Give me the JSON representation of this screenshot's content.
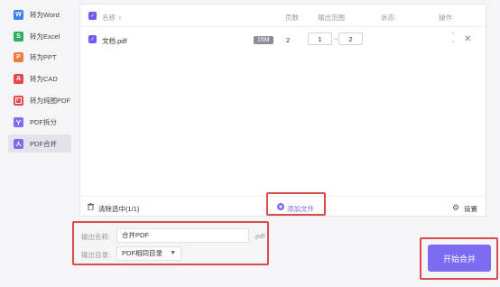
{
  "sidebar": {
    "items": [
      {
        "label": "转为Word",
        "icon": "word-icon",
        "glyph": "W",
        "color": "#3b7ff0"
      },
      {
        "label": "转为Excel",
        "icon": "excel-icon",
        "glyph": "S",
        "color": "#2fae62"
      },
      {
        "label": "转为PPT",
        "icon": "ppt-icon",
        "glyph": "P",
        "color": "#f07a3b"
      },
      {
        "label": "转为CAD",
        "icon": "cad-icon",
        "glyph": "A",
        "color": "#e24b4b"
      },
      {
        "label": "转为纯图PDF",
        "icon": "image-pdf-icon",
        "glyph": "▣",
        "color": "#e24b4b"
      },
      {
        "label": "PDF拆分",
        "icon": "split-icon",
        "glyph": "✂",
        "color": "#7b6cf2"
      },
      {
        "label": "PDF合并",
        "icon": "merge-icon",
        "glyph": "⊼",
        "color": "#7b6cf2"
      }
    ],
    "active_index": 6
  },
  "table": {
    "headers": {
      "name": "名称",
      "pages": "页数",
      "range": "输出范围",
      "status": "状态",
      "action": "操作"
    },
    "rows": [
      {
        "name": "文档.pdf",
        "size": "15M",
        "pages": "2",
        "range_from": "1",
        "range_sep": "~",
        "range_to": "2"
      }
    ]
  },
  "footer": {
    "clear_label": "清除选中(1/1)",
    "add_label": "添加文件",
    "settings_label": "设置"
  },
  "output": {
    "name_label": "输出名称:",
    "name_value": "合并PDF",
    "ext": ".pdf",
    "dir_label": "输出目录:",
    "dir_value": "PDF相同目录"
  },
  "start_button": "开始合并",
  "colors": {
    "accent": "#7b6cf2",
    "highlight": "#d94c4c"
  }
}
